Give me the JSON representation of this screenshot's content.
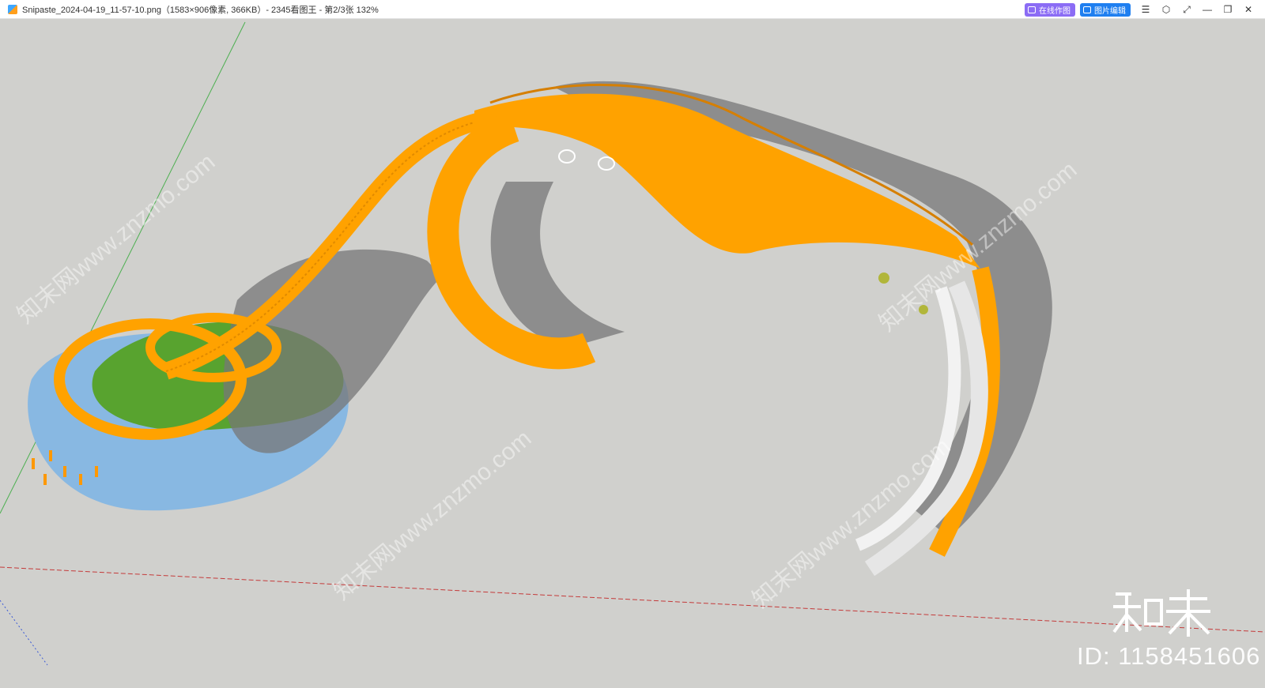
{
  "window": {
    "title": "Snipaste_2024-04-19_11-57-10.png（1583×906像素, 366KB）- 2345看图王 - 第2/3张 132%",
    "online_edit_label": "在线作图",
    "image_edit_label": "图片编辑"
  },
  "icons": [
    "app-logo-icon",
    "online-draw-icon",
    "image-edit-icon",
    "menu-icon",
    "skin-icon",
    "fullscreen-icon",
    "minimize-icon",
    "restore-icon",
    "close-icon"
  ],
  "watermark": {
    "repeat_text": "知末网www.znzmo.com",
    "logo_text": "知末",
    "id_text": "ID: 1158451606"
  },
  "colors": {
    "background": "#d0d0cd",
    "walkway": "#ffa200",
    "slide": "#e6e6e6",
    "lawn": "#58a32f",
    "water": "#88b8e2"
  }
}
